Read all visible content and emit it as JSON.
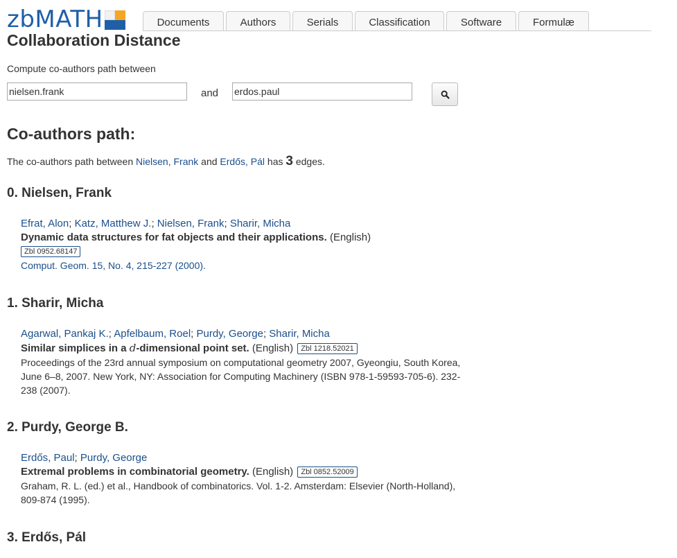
{
  "header": {
    "logo_text": "zbMATH",
    "tabs": [
      "Documents",
      "Authors",
      "Serials",
      "Classification",
      "Software",
      "Formulæ"
    ]
  },
  "page": {
    "title": "Collaboration Distance",
    "prompt": "Compute co-authors path between",
    "author_from": "nielsen.frank",
    "author_to": "erdos.paul",
    "and_label": "and",
    "search_icon": "search-icon"
  },
  "result": {
    "heading": "Co-authors path:",
    "summary_prefix": "The co-authors path between",
    "from_name": "Nielsen, Frank",
    "and_word": "and",
    "to_name": "Erdős, Pál",
    "has_word": "has",
    "edge_count": "3",
    "edges_word": "edges."
  },
  "steps": [
    {
      "heading": "0. Nielsen, Frank",
      "authors": [
        "Efrat, Alon",
        "Katz, Matthew J.",
        "Nielsen, Frank",
        "Sharir, Micha"
      ],
      "title": "Dynamic data structures for fat objects and their applications.",
      "language": "(English)",
      "zbl": "Zbl 0952.68147",
      "source": "Comput. Geom. 15, No. 4, 215-227 (2000)."
    },
    {
      "heading": "1. Sharir, Micha",
      "authors": [
        "Agarwal, Pankaj K.",
        "Apfelbaum, Roel",
        "Purdy, George",
        "Sharir, Micha"
      ],
      "title_pre": "Similar simplices in a ",
      "title_math": "d",
      "title_post": "-dimensional point set.",
      "language": "(English)",
      "zbl": "Zbl 1218.52021",
      "source": "Proceedings of the 23rd annual symposium on computational geometry 2007, Gyeongiu, South Korea, June 6–8, 2007. New York, NY: Association for Computing Machinery (ISBN 978-1-59593-705-6). 232-238 (2007)."
    },
    {
      "heading": "2. Purdy, George B.",
      "authors": [
        "Erdős, Paul",
        "Purdy, George"
      ],
      "title": "Extremal problems in combinatorial geometry.",
      "language": "(English)",
      "zbl": "Zbl 0852.52009",
      "source": "Graham, R. L. (ed.) et al., Handbook of combinatorics. Vol. 1-2. Amsterdam: Elsevier (North-Holland), 809-874 (1995)."
    },
    {
      "heading": "3. Erdős, Pál"
    }
  ],
  "colors": {
    "link": "#1a4f8b",
    "logo_blue": "#1f5fa8",
    "logo_orange": "#f5a623"
  }
}
